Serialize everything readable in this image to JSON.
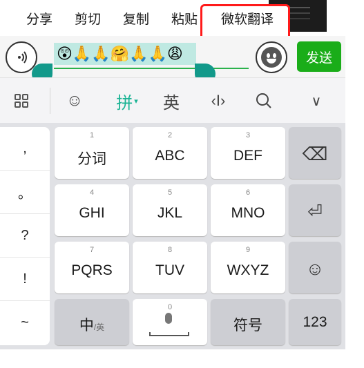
{
  "context_menu": {
    "items": [
      {
        "label": "分享"
      },
      {
        "label": "剪切"
      },
      {
        "label": "复制"
      },
      {
        "label": "粘贴"
      },
      {
        "label": "微软翻译"
      }
    ]
  },
  "input": {
    "selected_text": "😲🙏🙏🤗🙏🙏😩",
    "send_label": "发送",
    "voice_icon": "voice-icon",
    "emoji_icon": "emoji-icon"
  },
  "toolbar": {
    "items": [
      {
        "icon": "grid-icon"
      },
      {
        "icon": "smile-icon",
        "glyph": "☺"
      },
      {
        "label": "拼"
      },
      {
        "label": "英"
      },
      {
        "icon": "cursor-icon",
        "glyph": "‹I›"
      },
      {
        "icon": "search-icon",
        "glyph": "⚲"
      },
      {
        "icon": "chevron-down-icon",
        "glyph": "∨"
      }
    ]
  },
  "keyboard": {
    "punctuation": [
      ",",
      "。",
      "?",
      "!",
      "~"
    ],
    "keys": [
      {
        "num": "1",
        "label": "分词"
      },
      {
        "num": "2",
        "label": "ABC"
      },
      {
        "num": "3",
        "label": "DEF"
      },
      {
        "num": "4",
        "label": "GHI"
      },
      {
        "num": "5",
        "label": "JKL"
      },
      {
        "num": "6",
        "label": "MNO"
      },
      {
        "num": "7",
        "label": "PQRS"
      },
      {
        "num": "8",
        "label": "TUV"
      },
      {
        "num": "9",
        "label": "WXYZ"
      }
    ],
    "backspace_glyph": "⌫",
    "enter_glyph": "⏎",
    "emoji_glyph": "☺",
    "zh_label": "中",
    "zh_sub": "/英",
    "space_num": "0",
    "symbols_label": "符号",
    "numbers_label": "123"
  },
  "colors": {
    "accent": "#1aad19",
    "selection": "#bfe9e2",
    "handle": "#12998a",
    "highlight_box": "#ff1a1a"
  }
}
